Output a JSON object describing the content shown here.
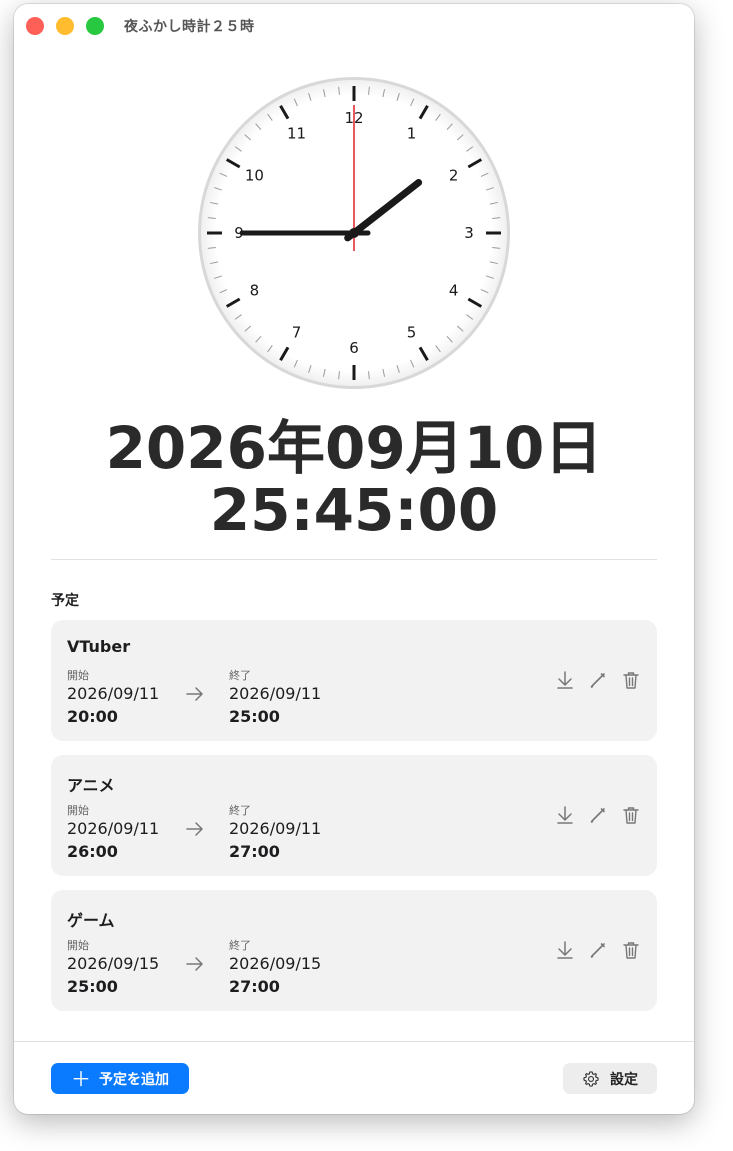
{
  "window": {
    "title": "夜ふかし時計２５時"
  },
  "clock": {
    "numerals": [
      "12",
      "1",
      "2",
      "3",
      "4",
      "5",
      "6",
      "7",
      "8",
      "9",
      "10",
      "11"
    ],
    "hour_hand_angle_deg": 52,
    "minute_hand_angle_deg": 270,
    "second_hand_angle_deg": 0
  },
  "display": {
    "date": "2026年09月10日",
    "time": "25:45:00"
  },
  "schedule": {
    "section_title": "予定",
    "start_label": "開始",
    "end_label": "終了",
    "items": [
      {
        "title": "VTuber",
        "start_date": "2026/09/11",
        "start_time": "20:00",
        "end_date": "2026/09/11",
        "end_time": "25:00"
      },
      {
        "title": "アニメ",
        "start_date": "2026/09/11",
        "start_time": "26:00",
        "end_date": "2026/09/11",
        "end_time": "27:00"
      },
      {
        "title": "ゲーム",
        "start_date": "2026/09/15",
        "start_time": "25:00",
        "end_date": "2026/09/15",
        "end_time": "27:00"
      }
    ]
  },
  "footer": {
    "add_label": "予定を追加",
    "settings_label": "設定"
  },
  "colors": {
    "accent": "#0a7aff",
    "second_hand": "#e0202a",
    "card_bg": "#f2f2f2"
  }
}
